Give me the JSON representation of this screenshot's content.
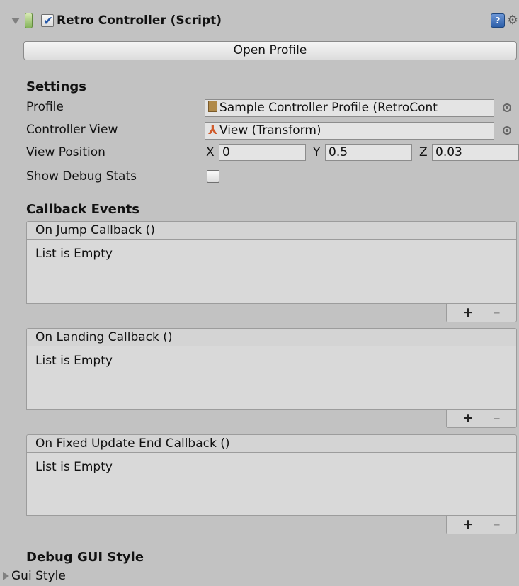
{
  "component": {
    "title": "Retro Controller (Script)",
    "enabled": true,
    "icons": {
      "foldout": "foldout-down-icon",
      "script": "script-icon",
      "help": "help-icon",
      "settings": "gear-icon"
    }
  },
  "open_profile_label": "Open Profile",
  "settings": {
    "title": "Settings",
    "profile": {
      "label": "Profile",
      "value": "Sample Controller Profile (RetroCont"
    },
    "controller_view": {
      "label": "Controller View",
      "value": "View (Transform)"
    },
    "view_position": {
      "label": "View Position",
      "x_label": "X",
      "x": "0",
      "y_label": "Y",
      "y": "0.5",
      "z_label": "Z",
      "z": "0.03"
    },
    "show_debug_stats": {
      "label": "Show Debug Stats",
      "checked": false
    }
  },
  "callback_events": {
    "title": "Callback Events",
    "events": [
      {
        "header": "On Jump Callback ()",
        "empty_text": "List is Empty"
      },
      {
        "header": "On Landing Callback ()",
        "empty_text": "List is Empty"
      },
      {
        "header": "On Fixed Update End Callback ()",
        "empty_text": "List is Empty"
      }
    ],
    "add_label": "+",
    "remove_label": "–"
  },
  "debug_gui_style": {
    "title": "Debug GUI Style",
    "gui_style_label": "Gui Style"
  },
  "colors": {
    "background": "#c2c2c2",
    "checkmark": "#2457a8",
    "script_icon": "#84b35a"
  }
}
